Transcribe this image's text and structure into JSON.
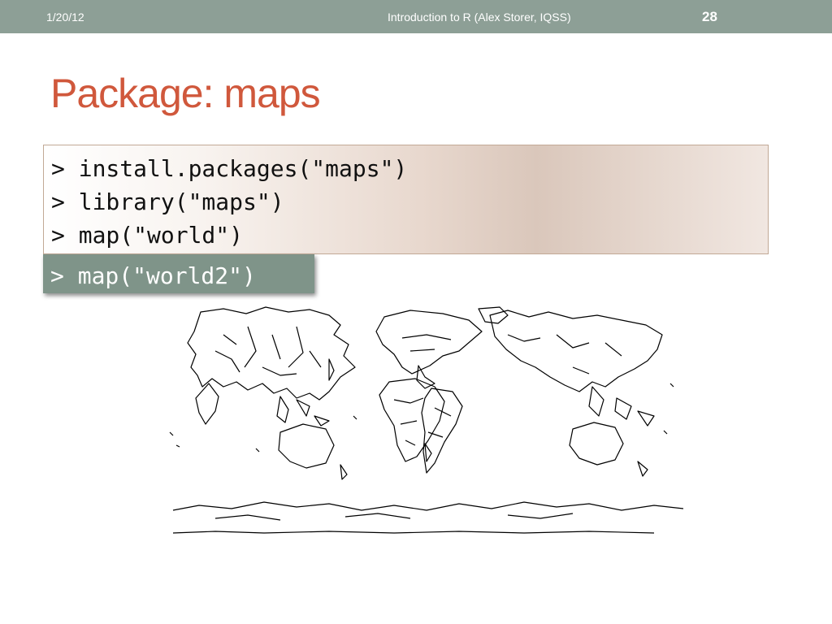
{
  "header": {
    "date": "1/20/12",
    "footer": "Introduction to R (Alex Storer, IQSS)",
    "page_number": "28"
  },
  "slide": {
    "title": "Package: maps"
  },
  "code_block": {
    "lines": [
      "> install.packages(\"maps\")",
      "> library(\"maps\")",
      "> map(\"world\")"
    ]
  },
  "code_callout": {
    "line": "> map(\"world2\")"
  },
  "image": {
    "icon": "world-map-outline-pacific-centered",
    "stroke_color": "#000000"
  }
}
